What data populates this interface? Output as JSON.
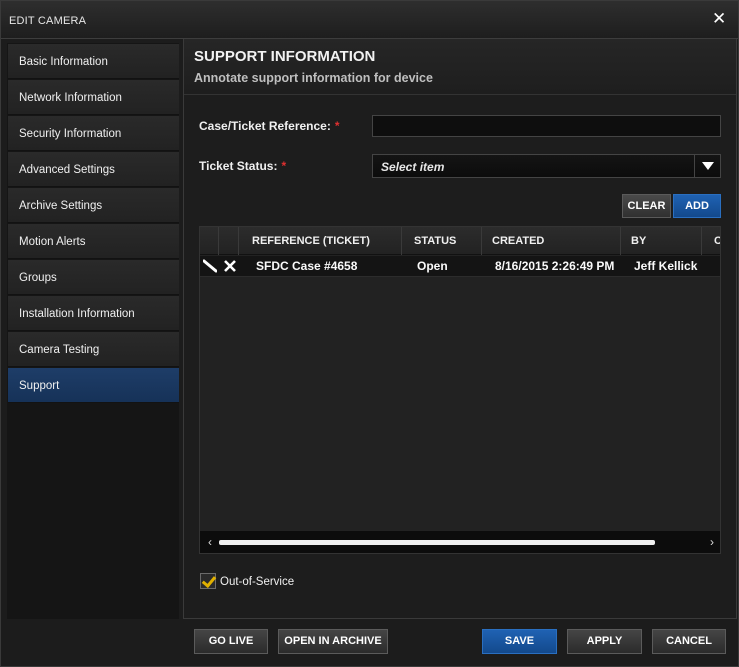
{
  "window": {
    "title": "EDIT CAMERA",
    "close_icon": "close-icon"
  },
  "sidebar": {
    "items": [
      {
        "label": "Basic Information"
      },
      {
        "label": "Network Information"
      },
      {
        "label": "Security Information"
      },
      {
        "label": "Advanced Settings"
      },
      {
        "label": "Archive Settings"
      },
      {
        "label": "Motion Alerts"
      },
      {
        "label": "Groups"
      },
      {
        "label": "Installation Information"
      },
      {
        "label": "Camera Testing"
      },
      {
        "label": "Support",
        "active": true
      }
    ]
  },
  "panel": {
    "title": "SUPPORT INFORMATION",
    "subtitle": "Annotate support information for device"
  },
  "form": {
    "ticket_ref_label": "Case/Ticket Reference:",
    "ticket_ref_value": "",
    "required_mark": "*",
    "status_label": "Ticket Status:",
    "status_value": "Select item"
  },
  "actions": {
    "clear": "CLEAR",
    "add": "ADD"
  },
  "grid": {
    "columns": [
      "REFERENCE (TICKET)",
      "STATUS",
      "CREATED",
      "BY",
      "C"
    ],
    "rows": [
      {
        "reference": "SFDC Case #4658",
        "status": "Open",
        "created": "8/16/2015 2:26:49 PM",
        "by": "Jeff Kellick"
      }
    ]
  },
  "out_of_service": {
    "label": "Out-of-Service",
    "checked": true
  },
  "footer": {
    "go_live": "GO LIVE",
    "open_archive": "OPEN IN ARCHIVE",
    "save": "SAVE",
    "apply": "APPLY",
    "cancel": "CANCEL"
  },
  "colors": {
    "accent": "#1f62b3",
    "active_nav": "#1e3d68",
    "required": "#e03030",
    "check": "#e0b000"
  }
}
